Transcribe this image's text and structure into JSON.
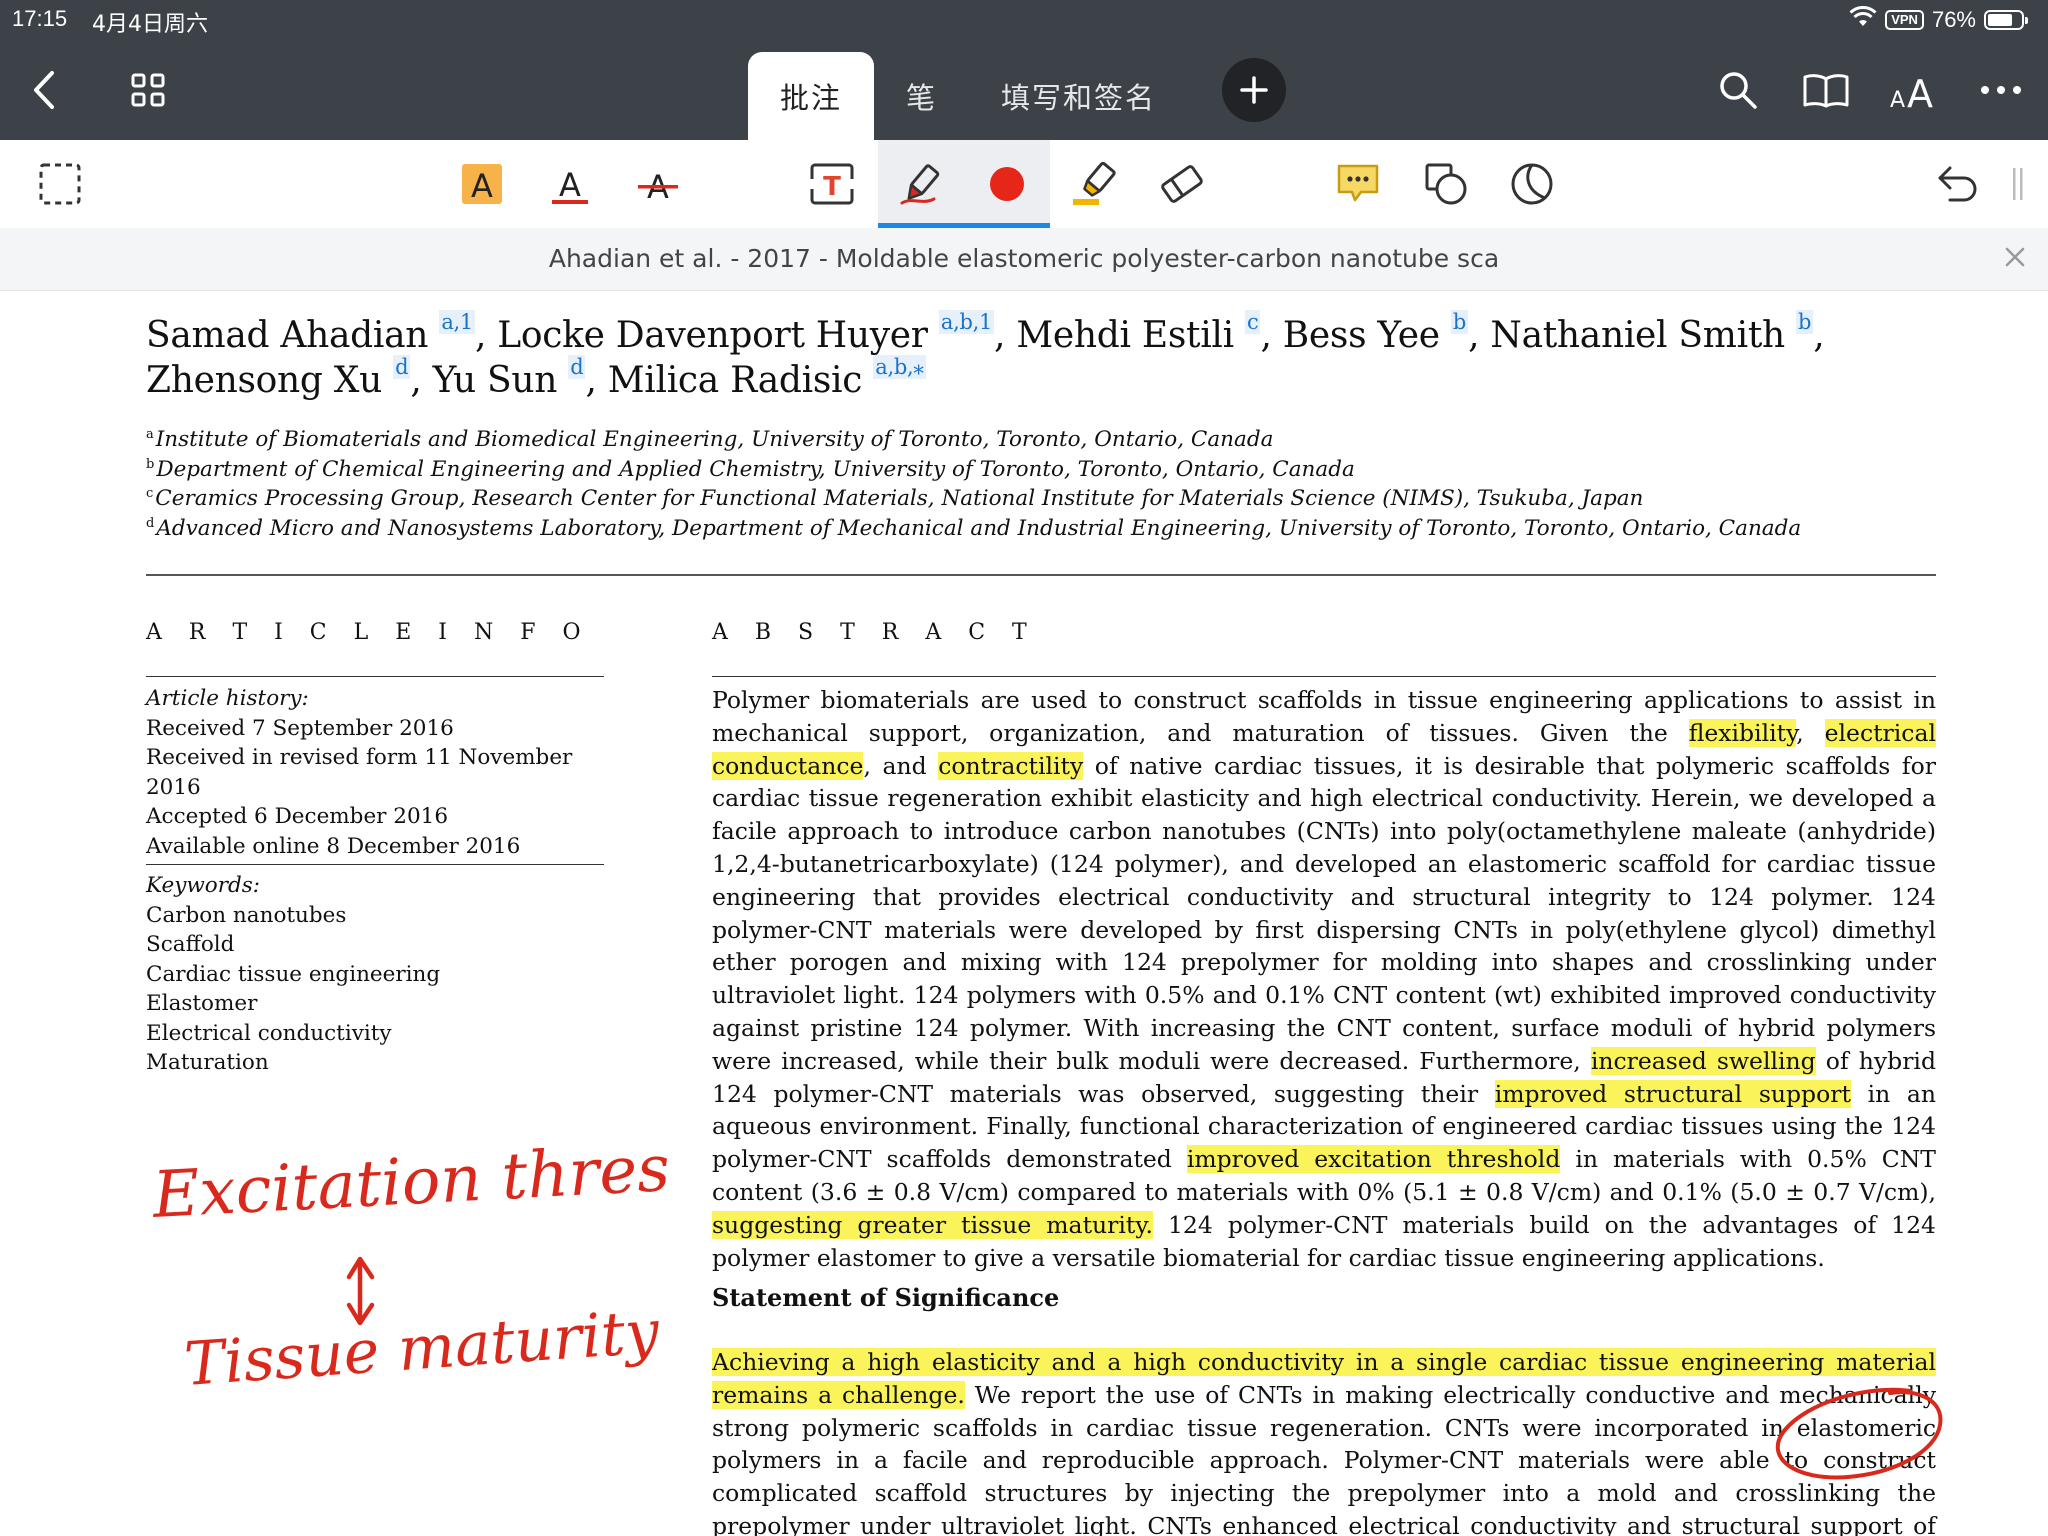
{
  "status_bar": {
    "time": "17:15",
    "date": "4月4日周六",
    "vpn": "VPN",
    "battery": "76%",
    "battery_level": 0.76
  },
  "tabs": [
    {
      "label": "批注",
      "active": true
    },
    {
      "label": "笔",
      "active": false
    },
    {
      "label": "填写和签名",
      "active": false
    }
  ],
  "toolbar": {
    "text_tool_letter": "A",
    "textbox_letter": "T",
    "colors": {
      "accent": "#1e88e5",
      "ink_red": "#d9291c",
      "highlight": "#fbf35a",
      "topbar": "#3d4148"
    }
  },
  "file": {
    "name": "Ahadian et al. - 2017 - Moldable elastomeric polyester-carbon nanotube sca"
  },
  "paper": {
    "authors": [
      {
        "name": "Samad Ahadian",
        "sup": "a,1",
        "sep": ", "
      },
      {
        "name": "Locke Davenport Huyer",
        "sup": "a,b,1",
        "sep": ", "
      },
      {
        "name": "Mehdi Estili",
        "sup": "c",
        "sep": ", "
      },
      {
        "name": "Bess Yee",
        "sup": "b",
        "sep": ", "
      },
      {
        "name": "Nathaniel Smith",
        "sup": "b",
        "sep": ", "
      },
      {
        "name": "Zhensong Xu",
        "sup": "d",
        "sep": ", "
      },
      {
        "name": "Yu Sun",
        "sup": "d",
        "sep": ", "
      },
      {
        "name": "Milica Radisic",
        "sup": "a,b,⁎",
        "sep": ""
      }
    ],
    "affiliations": [
      {
        "mark": "a",
        "text": "Institute of Biomaterials and Biomedical Engineering, University of Toronto, Toronto, Ontario, Canada"
      },
      {
        "mark": "b",
        "text": "Department of Chemical Engineering and Applied Chemistry, University of Toronto, Toronto, Ontario, Canada"
      },
      {
        "mark": "c",
        "text": "Ceramics Processing Group, Research Center for Functional Materials, National Institute for Materials Science (NIMS), Tsukuba, Japan"
      },
      {
        "mark": "d",
        "text": "Advanced Micro and Nanosystems Laboratory, Department of Mechanical and Industrial Engineering, University of Toronto, Toronto, Ontario, Canada"
      }
    ],
    "article_info_heading": "A R T I C L E  I N F O",
    "abstract_heading": "A B S T R A C T",
    "history": {
      "label": "Article history:",
      "lines": [
        "Received 7 September 2016",
        "Received in revised form 11 November 2016",
        "Accepted 6 December 2016",
        "Available online 8 December 2016"
      ]
    },
    "keywords": {
      "label": "Keywords:",
      "items": [
        "Carbon nanotubes",
        "Scaffold",
        "Cardiac tissue engineering",
        "Elastomer",
        "Electrical conductivity",
        "Maturation"
      ]
    },
    "abstract_segments": [
      {
        "t": "Polymer biomaterials are used to construct scaffolds in tissue engineering applications to assist in mechanical support, organization, and maturation of tissues. Given the ",
        "h": false
      },
      {
        "t": "flexibility",
        "h": true
      },
      {
        "t": ", ",
        "h": false
      },
      {
        "t": "electrical conductance",
        "h": true
      },
      {
        "t": ", and ",
        "h": false
      },
      {
        "t": "contractility",
        "h": true
      },
      {
        "t": " of native cardiac tissues, it is desirable that polymeric scaffolds for cardiac tissue regeneration exhibit elasticity and high electrical conductivity. Herein, we developed a facile approach to introduce carbon nanotubes (CNTs) into poly(octamethylene maleate (anhydride) 1,2,4-butanetricarboxylate) (124 polymer), and developed an elastomeric scaffold for cardiac tissue engineering that provides electrical conductivity and structural integrity to 124 polymer. 124 polymer-CNT materials were developed by first dispersing CNTs in poly(ethylene glycol) dimethyl ether porogen and mixing with 124 prepolymer for molding into shapes and crosslinking under ultraviolet light. 124 polymers with 0.5% and 0.1% CNT content (wt) exhibited improved conductivity against pristine 124 polymer. With increasing the CNT content, surface moduli of hybrid polymers were increased, while their bulk moduli were decreased. Furthermore, ",
        "h": false
      },
      {
        "t": "increased swelling",
        "h": true
      },
      {
        "t": " of hybrid 124 polymer-CNT materials was observed, suggesting their ",
        "h": false
      },
      {
        "t": "improved structural support",
        "h": true
      },
      {
        "t": " in an aqueous environment. Finally, functional characterization of engineered cardiac tissues using the 124 polymer-CNT scaffolds demonstrated ",
        "h": false
      },
      {
        "t": "improved excitation threshold",
        "h": true
      },
      {
        "t": " in materials with 0.5% CNT content (3.6 ± 0.8 V/cm) compared to materials with 0% (5.1 ± 0.8 V/cm) and 0.1% (5.0 ± 0.7 V/cm), ",
        "h": false
      },
      {
        "t": "suggesting greater tissue maturity.",
        "h": true
      },
      {
        "t": " 124 polymer-CNT materials build on the advantages of 124 polymer elastomer to give a versatile biomaterial for cardiac tissue engineering applications.",
        "h": false
      }
    ],
    "significance_heading": "Statement of Significance",
    "significance_segments": [
      {
        "t": "Achieving a high elasticity and a high conductivity in a single cardiac tissue engineering material remains a challenge.",
        "h": true
      },
      {
        "t": " We report the use of CNTs in making electrically conductive and mechanically strong polymeric scaffolds in cardiac tissue regeneration. CNTs were incorporated in elastomeric polymers in a facile and reproducible approach. Polymer-CNT materials were able to construct complicated scaffold structures by injecting the prepolymer into a mold and crosslinking the prepolymer under ultraviolet light. CNTs enhanced electrical conductivity and structural support of elastomeric polymers. Hybrid polymeric scaffolds contain-",
        "h": false
      }
    ]
  },
  "handwriting": {
    "line1": "Excitation threshold",
    "line2": "Tissue maturity"
  }
}
